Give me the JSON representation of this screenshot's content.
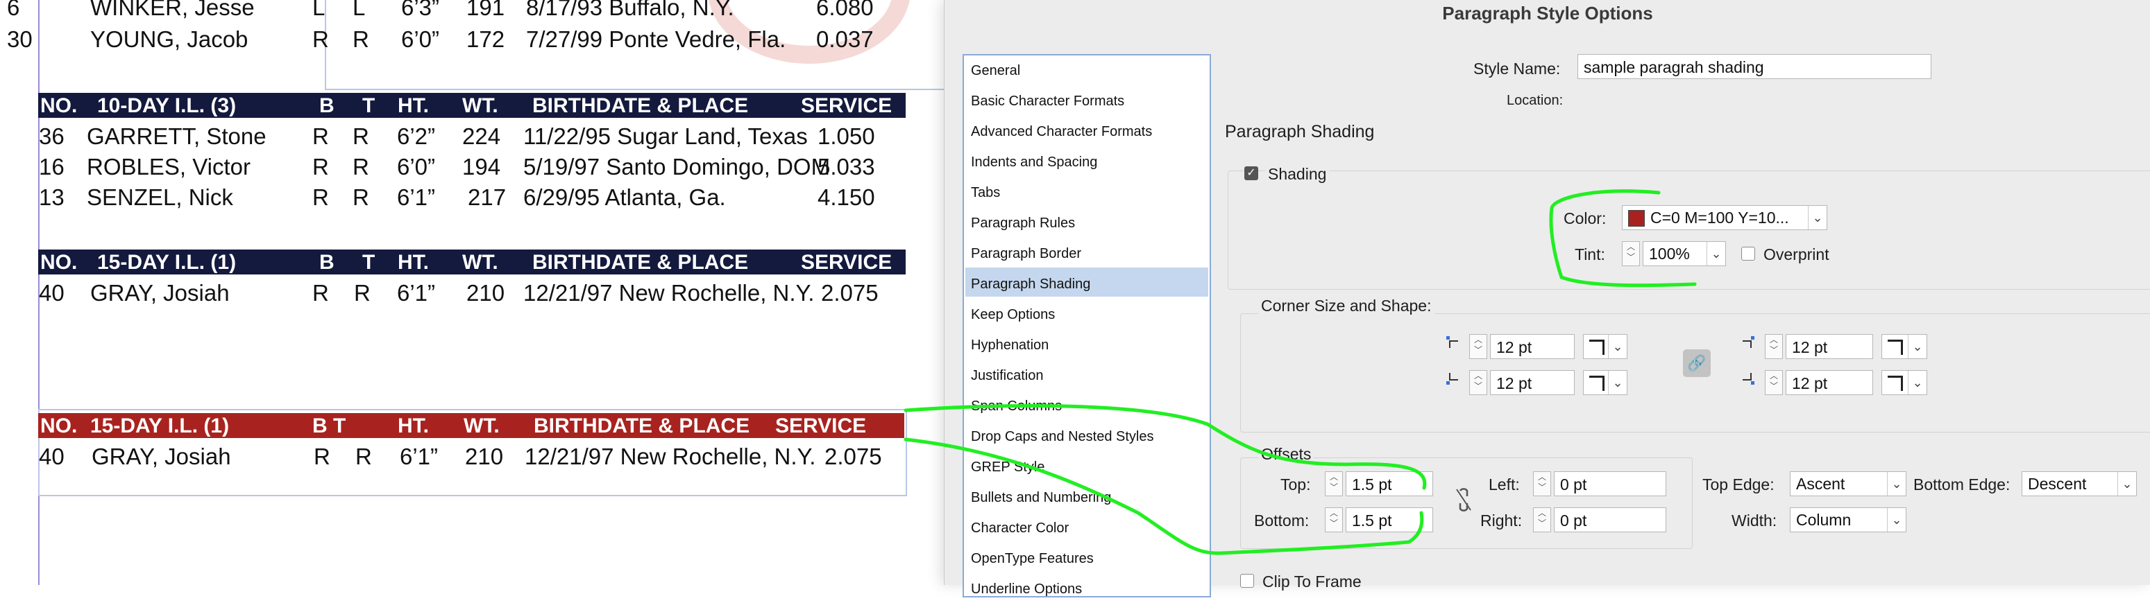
{
  "document": {
    "top_rows": [
      [
        "6",
        "WINKER, Jesse",
        "L",
        "L",
        "6’3”",
        "191",
        "8/17/93 Buffalo, N.Y.",
        "6.080"
      ],
      [
        "30",
        "YOUNG, Jacob",
        "R",
        "R",
        "6’0”",
        "172",
        "7/27/99 Ponte Vedre, Fla.",
        "0.037"
      ]
    ],
    "section_10day": {
      "header": [
        "NO.",
        "10-DAY I.L. (3)",
        "B",
        "T",
        "HT.",
        "WT.",
        "BIRTHDATE & PLACE",
        "SERVICE"
      ],
      "rows": [
        [
          "36",
          "GARRETT, Stone",
          "R",
          "R",
          "6’2”",
          "224",
          "11/22/95 Sugar Land, Texas",
          "1.050"
        ],
        [
          "16",
          "ROBLES, Victor",
          "R",
          "R",
          "6’0”",
          "194",
          "5/19/97 Santo Domingo, DOM",
          "5.033"
        ],
        [
          "13",
          "SENZEL, Nick",
          "R",
          "R",
          "6’1”",
          "217",
          "6/29/95 Atlanta, Ga.",
          "4.150"
        ]
      ]
    },
    "section_15day": {
      "header": [
        "NO.",
        "15-DAY I.L. (1)",
        "B",
        "T",
        "HT.",
        "WT.",
        "BIRTHDATE & PLACE",
        "SERVICE"
      ],
      "rows": [
        [
          "40",
          "GRAY, Josiah",
          "R",
          "R",
          "6’1”",
          "210",
          "12/21/97 New Rochelle, N.Y.",
          "2.075"
        ]
      ]
    },
    "section_15day_sample": {
      "header": [
        "NO.",
        "15-DAY I.L. (1)",
        "B T",
        "HT.",
        "WT.",
        "BIRTHDATE & PLACE",
        "SERVICE"
      ],
      "rows": [
        [
          "40",
          "GRAY, Josiah",
          "R",
          "R",
          "6’1”",
          "210",
          "12/21/97 New Rochelle, N.Y.",
          "2.075"
        ]
      ]
    }
  },
  "dialog": {
    "title": "Paragraph Style Options",
    "categories": [
      "General",
      "Basic Character Formats",
      "Advanced Character Formats",
      "Indents and Spacing",
      "Tabs",
      "Paragraph Rules",
      "Paragraph Border",
      "Paragraph Shading",
      "Keep Options",
      "Hyphenation",
      "Justification",
      "Span Columns",
      "Drop Caps and Nested Styles",
      "GREP Style",
      "Bullets and Numbering",
      "Character Color",
      "OpenType Features",
      "Underline Options"
    ],
    "selected_category_index": 7,
    "style_name_label": "Style Name:",
    "style_name_value": "sample paragrah shading",
    "location_label": "Location:",
    "section_title": "Paragraph Shading",
    "shading_label": "Shading",
    "shading_checked": true,
    "color_label": "Color:",
    "color_value": "C=0 M=100 Y=10...",
    "color_swatch": "#a8231f",
    "tint_label": "Tint:",
    "tint_value": "100%",
    "overprint_label": "Overprint",
    "corner_title": "Corner Size and Shape:",
    "corner_values": [
      "12 pt",
      "12 pt",
      "12 pt",
      "12 pt"
    ],
    "offsets_title": "Offsets",
    "top_label": "Top:",
    "top_value": "1.5 pt",
    "bottom_label": "Bottom:",
    "bottom_value": "1.5 pt",
    "left_label": "Left:",
    "left_value": "0 pt",
    "right_label": "Right:",
    "right_value": "0 pt",
    "top_edge_label": "Top Edge:",
    "top_edge_value": "Ascent",
    "bottom_edge_label": "Bottom Edge:",
    "bottom_edge_value": "Descent",
    "width_label": "Width:",
    "width_value": "Column",
    "clip_label": "Clip To Frame"
  },
  "colors": {
    "navy_header": "#141a3e",
    "red_header": "#a8231f",
    "annotation": "#22ee22",
    "selection": "#c5d7ee"
  }
}
